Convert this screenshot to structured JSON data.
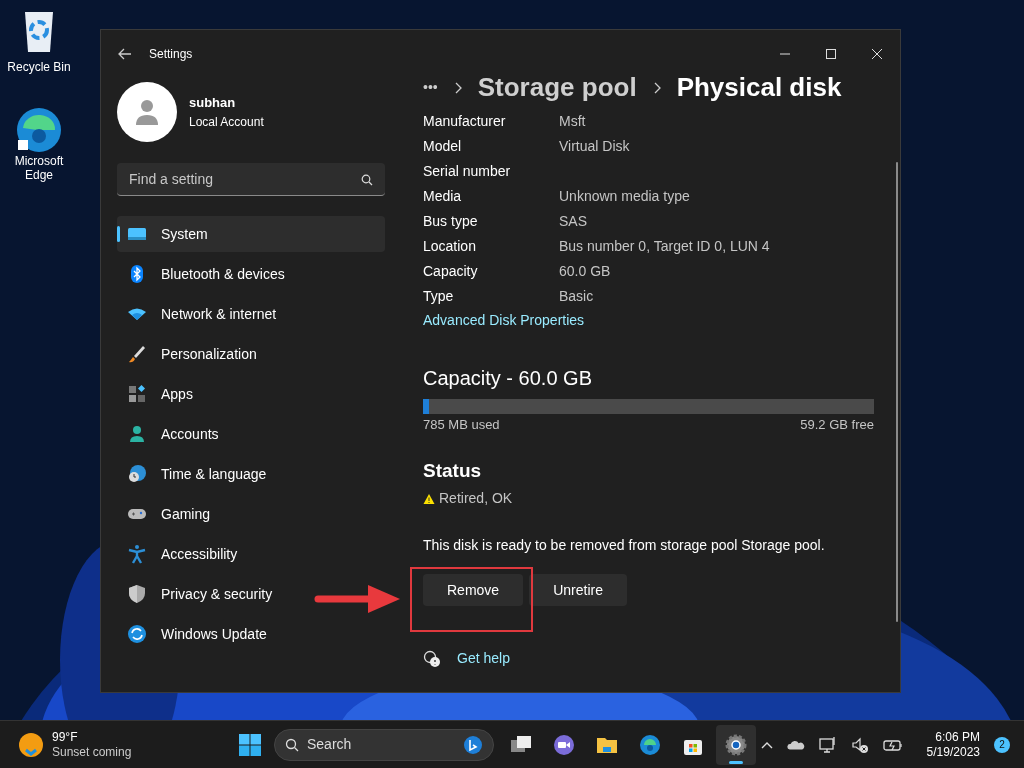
{
  "desktop_icons": [
    {
      "label": "Recycle Bin"
    },
    {
      "label": "Microsoft Edge"
    }
  ],
  "window": {
    "title": "Settings"
  },
  "account": {
    "name": "subhan",
    "type": "Local Account"
  },
  "search": {
    "placeholder": "Find a setting"
  },
  "sidebar": {
    "items": [
      {
        "label": "System",
        "selected": true
      },
      {
        "label": "Bluetooth & devices",
        "selected": false
      },
      {
        "label": "Network & internet",
        "selected": false
      },
      {
        "label": "Personalization",
        "selected": false
      },
      {
        "label": "Apps",
        "selected": false
      },
      {
        "label": "Accounts",
        "selected": false
      },
      {
        "label": "Time & language",
        "selected": false
      },
      {
        "label": "Gaming",
        "selected": false
      },
      {
        "label": "Accessibility",
        "selected": false
      },
      {
        "label": "Privacy & security",
        "selected": false
      },
      {
        "label": "Windows Update",
        "selected": false
      }
    ]
  },
  "breadcrumb": {
    "more": "•••",
    "items": [
      "Storage pool",
      "Physical disk"
    ]
  },
  "properties": [
    {
      "label": "Manufacturer",
      "value": "Msft"
    },
    {
      "label": "Model",
      "value": "Virtual Disk"
    },
    {
      "label": "Serial number"
    },
    {
      "label": "Media",
      "value": "Unknown media type"
    },
    {
      "label": "Bus type",
      "value": "SAS"
    },
    {
      "label": "Location",
      "value": "Bus number 0, Target ID 0, LUN 4"
    },
    {
      "label": "Capacity",
      "value": "60.0 GB"
    },
    {
      "label": "Type",
      "value": "Basic"
    }
  ],
  "advanced_link": "Advanced Disk Properties",
  "capacity": {
    "title": "Capacity - 60.0 GB",
    "level": 0.013,
    "used": "785 MB used",
    "free": "59.2 GB free"
  },
  "status": {
    "title": "Status",
    "value": "Retired, OK",
    "message": "This disk is ready to be removed from storage pool Storage pool."
  },
  "buttons": [
    "Remove",
    "Unretire"
  ],
  "help_link": "Get help",
  "taskbar": {
    "weather": {
      "temp": "99°F",
      "text": "Sunset coming"
    },
    "search": "Search",
    "apps": [
      {
        "selected": false
      },
      {
        "selected": false
      },
      {
        "selected": false
      },
      {
        "selected": false
      },
      {
        "selected": false
      },
      {
        "selected": true
      }
    ],
    "time": "6:06 PM",
    "date": "5/19/2023",
    "notifications": "2"
  }
}
